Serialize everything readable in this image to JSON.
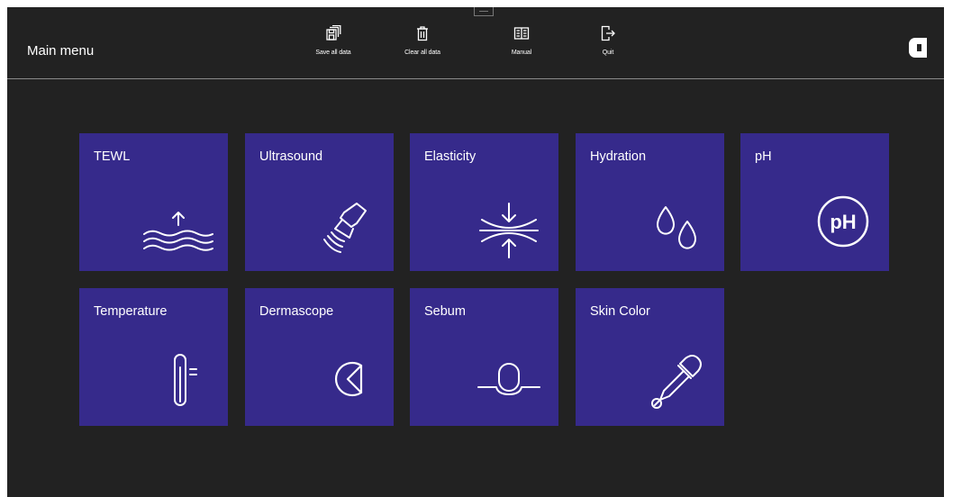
{
  "header": {
    "title": "Main menu",
    "toolbar": [
      {
        "label": "Save all data",
        "icon": "save-all-icon"
      },
      {
        "label": "Clear all data",
        "icon": "trash-icon"
      },
      {
        "label": "Manual",
        "icon": "book-icon"
      },
      {
        "label": "Quit",
        "icon": "exit-icon"
      }
    ],
    "logo_icon": "brand-logo-icon"
  },
  "tiles": [
    {
      "label": "TEWL",
      "icon": "evaporation-icon"
    },
    {
      "label": "Ultrasound",
      "icon": "ultrasound-probe-icon"
    },
    {
      "label": "Elasticity",
      "icon": "compression-icon"
    },
    {
      "label": "Hydration",
      "icon": "water-drops-icon"
    },
    {
      "label": "pH",
      "icon": "ph-icon",
      "icon_text": "pH"
    },
    {
      "label": "Temperature",
      "icon": "thermometer-icon"
    },
    {
      "label": "Dermascope",
      "icon": "dermascope-icon"
    },
    {
      "label": "Sebum",
      "icon": "sebum-icon"
    },
    {
      "label": "Skin Color",
      "icon": "eyedropper-icon"
    }
  ],
  "colors": {
    "background": "#222222",
    "tile": "#362a8b",
    "text": "#ffffff"
  }
}
